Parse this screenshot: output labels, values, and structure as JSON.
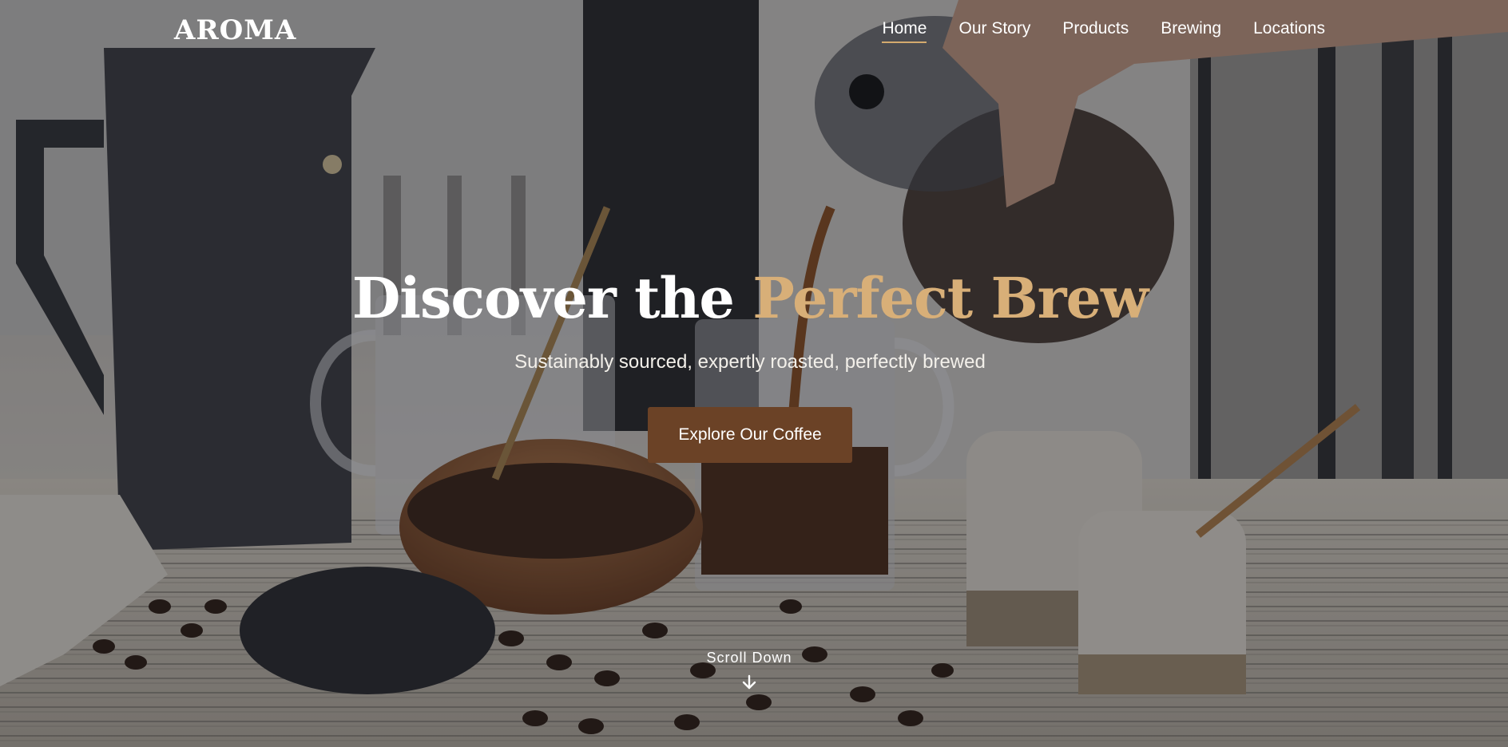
{
  "brand": {
    "logo_text": "AROMA",
    "accent_color": "#d8af78",
    "button_color": "#6b4226"
  },
  "nav": {
    "items": [
      {
        "label": "Home",
        "active": true
      },
      {
        "label": "Our Story",
        "active": false
      },
      {
        "label": "Products",
        "active": false
      },
      {
        "label": "Brewing",
        "active": false
      },
      {
        "label": "Locations",
        "active": false
      }
    ]
  },
  "hero": {
    "headline_plain": "Discover the ",
    "headline_accent": "Perfect Brew",
    "subheadline": "Sustainably sourced, expertly roasted, perfectly brewed",
    "cta_label": "Explore Our Coffee",
    "scroll_label": "Scroll Down",
    "scroll_icon": "arrow-down-icon",
    "background": "coffee-table-photo"
  }
}
